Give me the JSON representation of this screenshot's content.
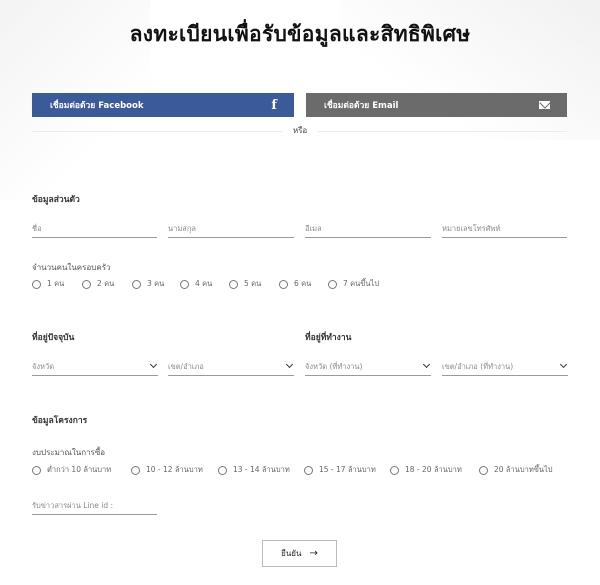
{
  "page": {
    "title": "ลงทะเบียนเพื่อรับข้อมูลและสิทธิพิเศษ"
  },
  "social": {
    "facebook_label": "เชื่อมต่อด้วย Facebook",
    "facebook_icon": "f",
    "email_label": "เชื่อมต่อด้วย Email",
    "or_text": "หรือ"
  },
  "personal": {
    "section_title": "ข้อมูลส่วนตัว",
    "first_name_placeholder": "ชื่อ",
    "last_name_placeholder": "นามสกุล",
    "email_placeholder": "อีเมล",
    "phone_placeholder": "หมายเลขโทรศัพท์"
  },
  "household": {
    "label": "จำนวนคนในครอบครัว",
    "options": [
      "1 คน",
      "2 คน",
      "3 คน",
      "4 คน",
      "5 คน",
      "6 คน",
      "7 คนขึ้นไป"
    ]
  },
  "address": {
    "home_title": "ที่อยู่ปัจจุบัน",
    "work_title": "ที่อยู่ที่ทำงาน",
    "home_province": "จังหวัด",
    "home_district": "เขต/อำเภอ",
    "work_province": "จังหวัด (ที่ทำงาน)",
    "work_district": "เขต/อำเภอ (ที่ทำงาน)"
  },
  "project": {
    "section_title": "ข้อมูลโครงการ",
    "budget_label": "งบประมาณในการซื้อ",
    "budget_options": [
      "ต่ำกว่า 10 ล้านบาท",
      "10 - 12 ล้านบาท",
      "13 - 14 ล้านบาท",
      "15 - 17 ล้านบาท",
      "18 - 20 ล้านบาท",
      "20 ล้านบาทขึ้นไป"
    ],
    "line_placeholder": "รับข่าวสารผ่าน Line id :"
  },
  "submit": {
    "label": "ยืนยัน",
    "arrow": "→"
  }
}
